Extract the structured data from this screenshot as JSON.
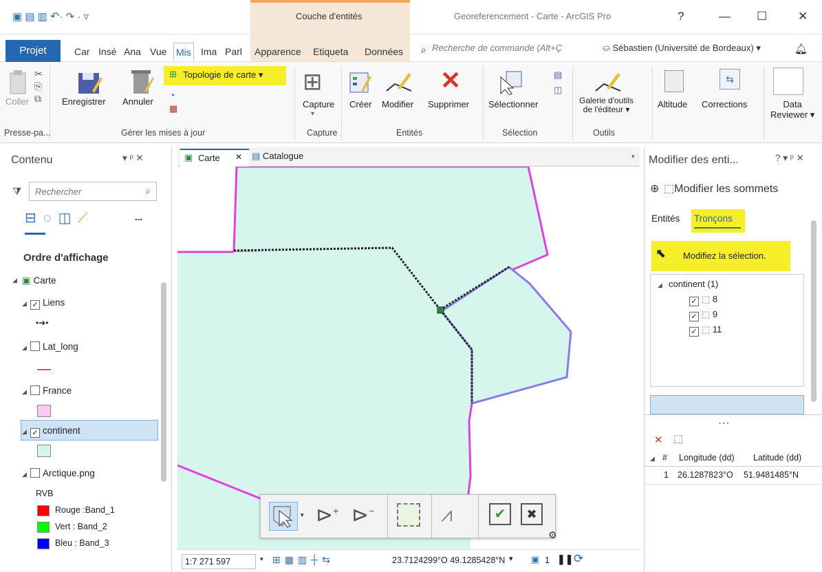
{
  "title_bar": {
    "contextual_tab": "Couche d'entités",
    "window_title": "Georeferencement - Carte - ArcGIS Pro",
    "help": "?",
    "minimize": "—",
    "maximize": "☐",
    "close": "✕"
  },
  "tabs": {
    "projet": "Projet",
    "items": [
      "Car",
      "Insé",
      "Ana",
      "Vue",
      "Mis",
      "Ima",
      "Parl",
      "Apparence",
      "Etiqueta",
      "Données"
    ],
    "search_placeholder": "Recherche de commande (Alt+Ç",
    "user": "Sébastien (Université de Bordeaux) ▾",
    "active": "Mis"
  },
  "ribbon": {
    "coller": "Coller",
    "enregistrer": "Enregistrer",
    "annuler": "Annuler",
    "topologie": "Topologie de carte",
    "capture": "Capture",
    "creer": "Créer",
    "modifier": "Modifier",
    "supprimer": "Supprimer",
    "selectionner": "Sélectionner",
    "galerie_line1": "Galerie d'outils",
    "galerie_line2": "de l'éditeur ▾",
    "altitude": "Altitude",
    "corrections": "Corrections",
    "data_line1": "Data",
    "data_line2": "Reviewer ▾",
    "groups": {
      "presse": "Presse-pa...",
      "gerer": "Gérer les mises à jour",
      "capture": "Capture",
      "entites": "Entités",
      "selection": "Sélection",
      "outils": "Outils"
    }
  },
  "contents": {
    "title": "Contenu",
    "pin": "▾ ᵖ ✕",
    "search_placeholder": "Rechercher",
    "more": "...",
    "order_heading": "Ordre d'affichage",
    "layers": {
      "carte": "Carte",
      "liens": "Liens",
      "lat_long": "Lat_long",
      "france": "France",
      "continent": "continent",
      "arctique": "Arctique.png",
      "rvb": "RVB",
      "rouge": "Rouge :Band_1",
      "vert": "Vert : Band_2",
      "bleu": "Bleu : Band_3"
    },
    "colors": {
      "lat_long_line": "#e8505b",
      "france_fill": "#f9c9ef",
      "continent_fill": "#d6f5ec",
      "rouge": "#ff0000",
      "vert": "#00ff00",
      "bleu": "#0000ff"
    }
  },
  "map": {
    "tab_carte": "Carte",
    "tab_catalogue": "Catalogue",
    "scale": "1:7 271 597",
    "coords": "23.7124299°O 49.1285428°N",
    "page": "1"
  },
  "modify_pane": {
    "title": "Modifier des enti...",
    "controls": "? ▾ ᵖ ✕",
    "tool_title": "Modifier les sommets",
    "tab_entites": "Entités",
    "tab_troncons": "Tronçons",
    "hint": "Modifiez la sélection.",
    "tree_root": "continent  (1)",
    "items": [
      "8",
      "9",
      "11"
    ],
    "dots": "• • •",
    "table_headers": [
      "#",
      "Longitude (dd)",
      "Latitude (dd)"
    ],
    "table_rows": [
      {
        "num": "1",
        "lon": "26.1287823°O",
        "lat": "51.9481485°N"
      }
    ]
  },
  "accent": {
    "blue": "#2467b3",
    "highlight": "#f7ee2a",
    "magenta": "#e040e0",
    "purple_edge": "#8a7be8",
    "fill": "#d6f5ec"
  }
}
